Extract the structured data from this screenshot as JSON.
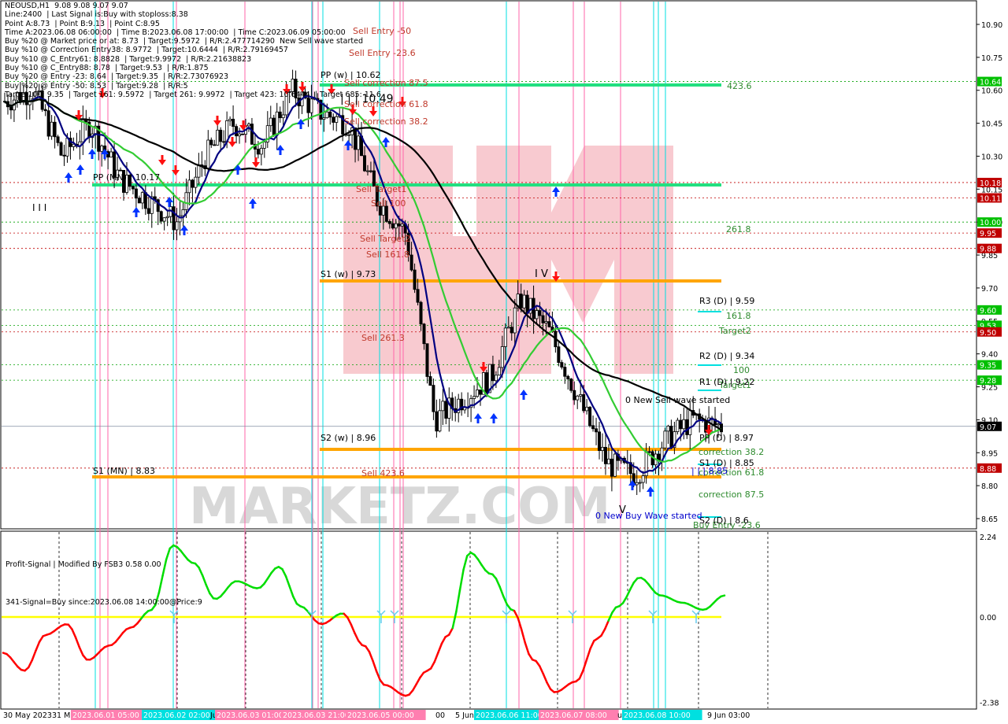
{
  "header": {
    "lines": [
      "NEOUSD,H1  9.08 9.08 9.07 9.07",
      "Line:2400  | Last Signal is:Buy with stoploss:8.38",
      "Point A:8.73  | Point B:9.13  | Point C:8.95",
      "Time A:2023.06.08 06:00:00  | Time B:2023.06.08 17:00:00  | Time C:2023.06.09 05:00:00",
      "Buy %20 @ Market price or at: 8.73  | Target:9.5972  | R/R:2.477714290  New Sell wave started",
      "Buy %10 @ Correction Entry38: 8.9772  | Target:10.6444  | R/R:2.79169457",
      "Buy %10 @ C_Entry61: 8.8828  | Target:9.9972  | R/R:2.21638823",
      "Buy %10 @ C_Entry88: 8.78  | Target:9.53  | R/R:1.875",
      "Buy %20 @ Entry -23: 8.64  | Target:9.35  | R/R:2.73076923",
      "Buy %20 @ Entry -50: 8.53  | Target:9.28  | R/R:5",
      "Target100: 9.35  | Target 161: 9.5972  | Target 261: 9.9972  | Target 423: 10.6444  | Target 685: 11.6"
    ]
  },
  "price_axis": {
    "ticks": [
      "10.90",
      "10.75",
      "10.60",
      "10.45",
      "10.30",
      "10.15",
      "10.00",
      "9.85",
      "9.70",
      "9.55",
      "9.40",
      "9.25",
      "9.10",
      "8.95",
      "8.80",
      "8.65"
    ],
    "markers": [
      {
        "label": "10.64",
        "color": "#00c000"
      },
      {
        "label": "10.18",
        "color": "#c00000"
      },
      {
        "label": "10.11",
        "color": "#c00000"
      },
      {
        "label": "10.00",
        "color": "#00c000"
      },
      {
        "label": "9.95",
        "color": "#c00000"
      },
      {
        "label": "9.88",
        "color": "#c00000"
      },
      {
        "label": "9.60",
        "color": "#00c000"
      },
      {
        "label": "9.53",
        "color": "#00c000"
      },
      {
        "label": "9.50",
        "color": "#c00000"
      },
      {
        "label": "9.35",
        "color": "#00c000"
      },
      {
        "label": "9.28",
        "color": "#00c000"
      },
      {
        "label": "9.07",
        "color": "#000000"
      },
      {
        "label": "8.88",
        "color": "#c00000"
      }
    ]
  },
  "time_axis": {
    "labels": [
      "30 May 2023",
      "31 M",
      "2023.06.01 05:00",
      "2023.06.02 02:00",
      "Ju",
      "2023.06.03 01:00",
      "2023.06.03 21:00",
      "2023.06.05 00:00",
      "00",
      "5 Jun",
      "2023.06.06 11:00",
      "2023.06.07 08:00",
      "un",
      "2023.06.08 10:00",
      "9 Jun 03:00"
    ]
  },
  "levels": [
    {
      "label": "PP (w) | 10.62",
      "color": "#00e060"
    },
    {
      "label": "PP (MN) | 10.17",
      "color": "#00e060"
    },
    {
      "label": "S1 (w) | 9.73",
      "color": "#ffa000"
    },
    {
      "label": "S2 (w) | 8.96",
      "color": "#ffa000"
    },
    {
      "label": "S1 (MN) | 8.83",
      "color": "#ffa000"
    }
  ],
  "labels_red": [
    "Sell Entry -50",
    "Sell Entry -23.6",
    "Sell correction 87.5",
    "Sell correction 61.8",
    "Sell correction 38.2",
    "Sell Target1",
    "Sell 100",
    "Sell Target2",
    "Sell 161.8",
    "Sell  261.3",
    "Sell  423.6"
  ],
  "labels_green": [
    "423.6",
    "261.8",
    "161.8",
    "Target2",
    "100",
    "Target1",
    "correction 38.2",
    "correction 61.8",
    "correction 87.5",
    "Buy Entry -23.6"
  ],
  "labels_daily": [
    "R3 (D) | 9.59",
    "R2 (D) | 9.34",
    "R1 (D) | 9.22",
    "PP (D) | 8.97",
    "S1 (D) | 8.85",
    "S2 (D) | 8.6"
  ],
  "labels_misc": {
    "sell_wave": "0 New Sell wave started",
    "buy_wave": "0 New Buy Wave started",
    "wave_a": "| | | 10.49",
    "wave_iv": "I V",
    "wave_v": "V",
    "wave_iii": "I I I",
    "fib_blue": "| | | 8.85"
  },
  "indicator": {
    "title": "Profit-Signal | Modified By FSB3 0.58 0.00",
    "signal": "341-Signal=Buy since:2023.06.08 14:00:00@Price:9",
    "ticks": [
      "2.24",
      "0.00",
      "-2.38"
    ]
  },
  "colors": {
    "bull": "#00dd00",
    "bear": "#ff0000",
    "zero": "#ffff00",
    "ma_fast": "#000080",
    "ma_mid": "#33cc33",
    "ma_slow": "#000000"
  },
  "chart_data": {
    "type": "line",
    "symbol": "NEOUSD",
    "timeframe": "H1",
    "ohlc_last": {
      "open": 9.08,
      "high": 9.08,
      "low": 9.07,
      "close": 9.07
    },
    "price_ylim": [
      8.6,
      10.96
    ],
    "price_path": [
      {
        "t": "30 May",
        "close": 10.55
      },
      {
        "t": "30 May",
        "close": 10.6
      },
      {
        "t": "31 May",
        "close": 10.3
      },
      {
        "t": "31 May",
        "close": 10.45
      },
      {
        "t": "1 Jun",
        "close": 10.2
      },
      {
        "t": "1 Jun",
        "close": 10.1
      },
      {
        "t": "2 Jun",
        "close": 10.0
      },
      {
        "t": "2 Jun",
        "close": 10.3
      },
      {
        "t": "3 Jun",
        "close": 10.45
      },
      {
        "t": "3 Jun",
        "close": 10.35
      },
      {
        "t": "4 Jun",
        "close": 10.6
      },
      {
        "t": "4 Jun",
        "close": 10.5
      },
      {
        "t": "5 Jun",
        "close": 10.45
      },
      {
        "t": "5 Jun",
        "close": 10.1
      },
      {
        "t": "5 Jun",
        "close": 9.95
      },
      {
        "t": "5 Jun",
        "close": 9.1
      },
      {
        "t": "6 Jun",
        "close": 9.2
      },
      {
        "t": "6 Jun",
        "close": 9.3
      },
      {
        "t": "6 Jun",
        "close": 9.65
      },
      {
        "t": "7 Jun",
        "close": 9.5
      },
      {
        "t": "7 Jun",
        "close": 9.2
      },
      {
        "t": "8 Jun",
        "close": 8.9
      },
      {
        "t": "8 Jun",
        "close": 8.85
      },
      {
        "t": "8 Jun",
        "close": 9.0
      },
      {
        "t": "9 Jun",
        "close": 9.1
      },
      {
        "t": "9 Jun",
        "close": 9.07
      }
    ],
    "indicator_ylim": [
      -2.38,
      2.24
    ],
    "indicator_path": [
      -1.0,
      -1.5,
      -0.5,
      -0.2,
      -1.2,
      -0.8,
      -0.3,
      0.2,
      2.0,
      1.5,
      0.5,
      1.0,
      0.8,
      1.4,
      0.3,
      -0.2,
      0.1,
      -0.8,
      -1.9,
      -2.2,
      -1.5,
      -0.5,
      1.8,
      1.2,
      0.2,
      -1.2,
      -2.1,
      -1.8,
      -0.6,
      0.3,
      1.1,
      0.6,
      0.4,
      0.2,
      0.6
    ]
  }
}
